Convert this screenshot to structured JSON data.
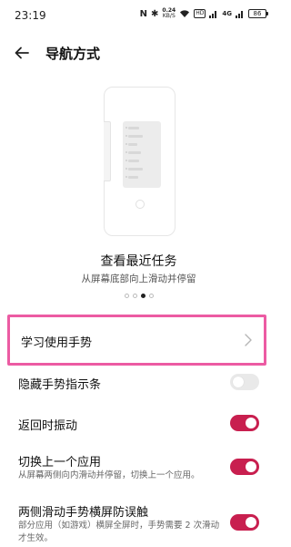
{
  "status_bar": {
    "time": "23:19",
    "speed_value": "0.24",
    "speed_unit": "KB/S",
    "hd": "HD",
    "network": "4G",
    "battery": "86"
  },
  "header": {
    "title": "导航方式"
  },
  "demo": {
    "title": "查看最近任务",
    "subtitle": "从屏幕底部向上滑动并停留",
    "pager_total": 4,
    "pager_active": 3
  },
  "learn_gestures": {
    "label": "学习使用手势"
  },
  "settings": [
    {
      "label": "隐藏手势指示条",
      "enabled": false
    },
    {
      "label": "返回时振动",
      "enabled": true
    },
    {
      "label": "切换上一个应用",
      "description": "从屏幕两侧向内滑动并停留，切换上一个应用。",
      "enabled": true
    },
    {
      "label": "两侧滑动手势横屏防误触",
      "description": "部分应用（如游戏）横屏全屏时，手势需要 2 次滑动才生效。",
      "enabled": true
    }
  ],
  "colors": {
    "toggle_on": "#c81f4f",
    "highlight_border": "#ec5ba3"
  }
}
